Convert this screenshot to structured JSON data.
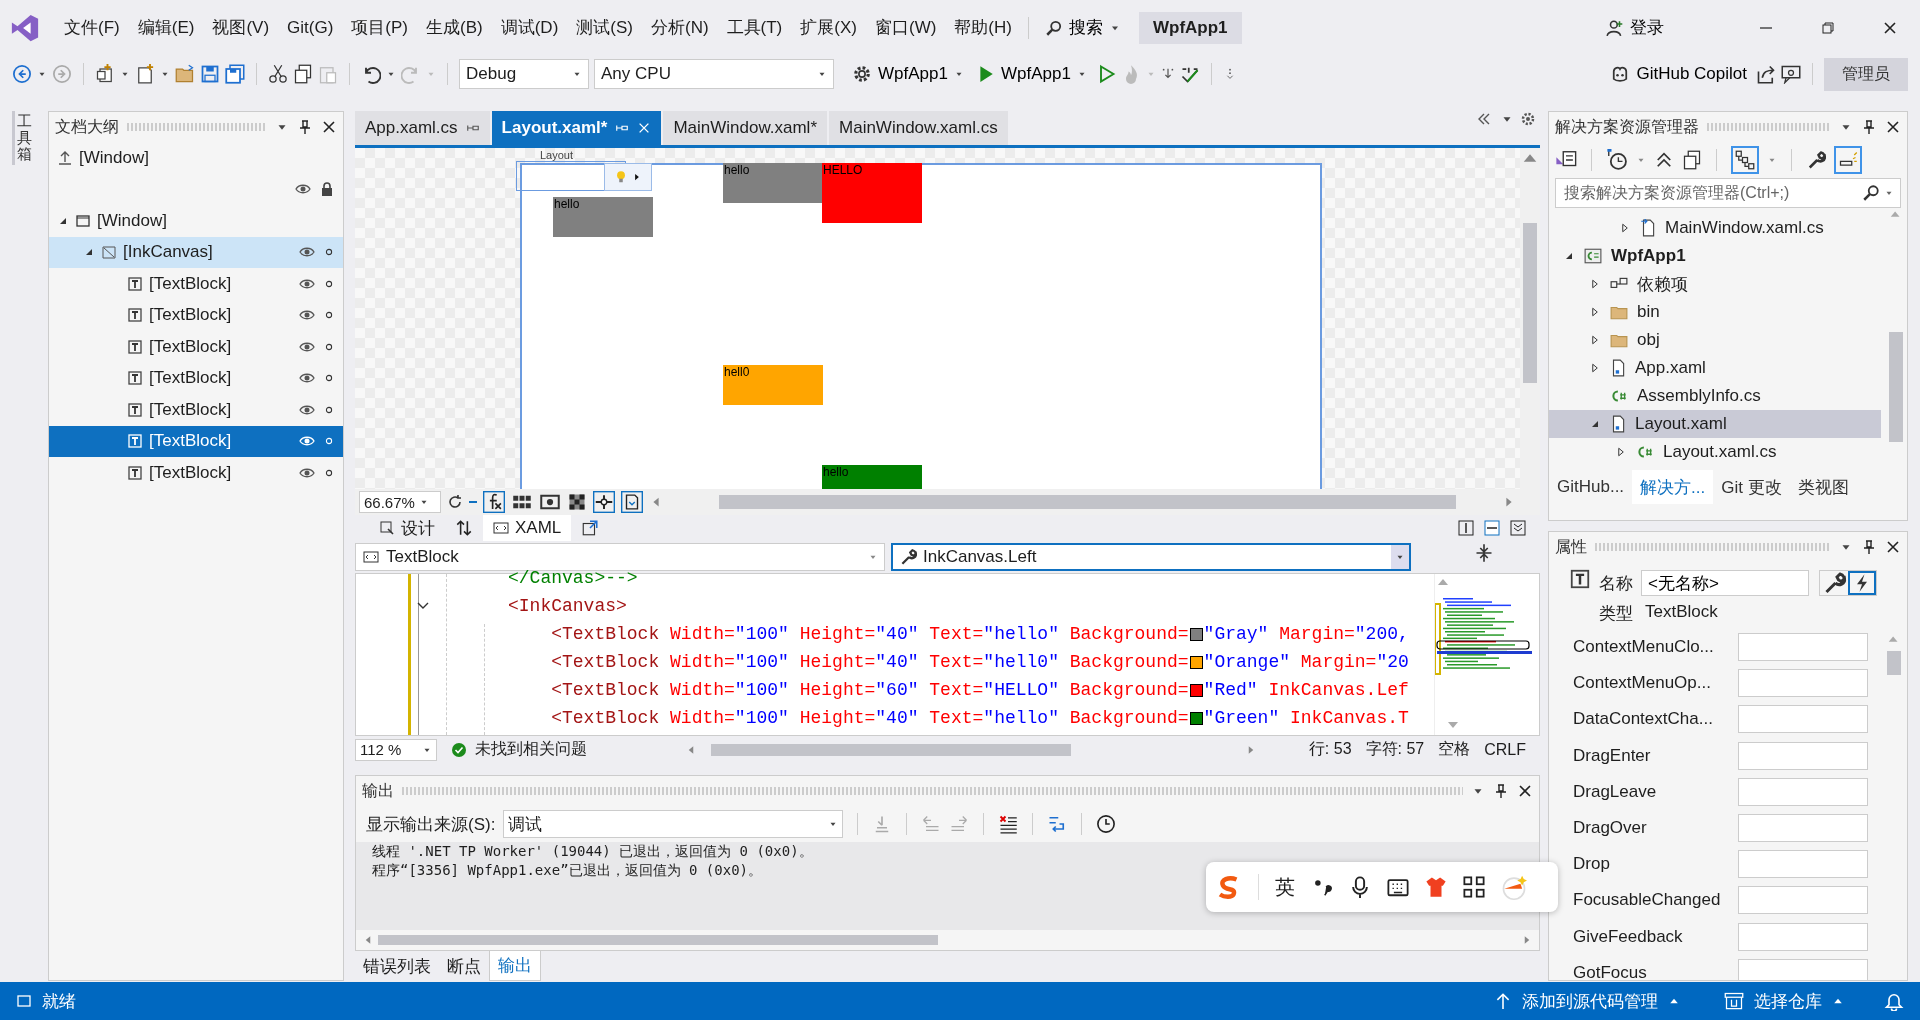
{
  "menu_bar": {
    "items": [
      "文件(F)",
      "编辑(E)",
      "视图(V)",
      "Git(G)",
      "项目(P)",
      "生成(B)",
      "调试(D)",
      "测试(S)",
      "分析(N)",
      "工具(T)",
      "扩展(X)",
      "窗口(W)",
      "帮助(H)"
    ],
    "search": "搜索",
    "solution": "WpfApp1",
    "login": "登录"
  },
  "toolbar": {
    "configuration": "Debug",
    "platform": "Any CPU",
    "startup_project": "WpfApp1",
    "run_target": "WpfApp1",
    "copilot": "GitHub Copilot",
    "admin": "管理员"
  },
  "toolbox_tab": "工具箱",
  "document_outline": {
    "title": "文档大纲",
    "scope": "[Window]",
    "tree": [
      {
        "label": "[Window]",
        "expanded": true,
        "selected": false,
        "highlighted": false,
        "children": [
          {
            "label": "[InkCanvas]",
            "expanded": true,
            "selected": false,
            "highlighted": true,
            "children": [
              {
                "label": "[TextBlock]",
                "selected": false
              },
              {
                "label": "[TextBlock]",
                "selected": false
              },
              {
                "label": "[TextBlock]",
                "selected": false
              },
              {
                "label": "[TextBlock]",
                "selected": false
              },
              {
                "label": "[TextBlock]",
                "selected": false
              },
              {
                "label": "[TextBlock]",
                "selected": true
              },
              {
                "label": "[TextBlock]",
                "selected": false
              }
            ]
          }
        ]
      }
    ]
  },
  "doc_tabs": [
    {
      "label": "App.xaml.cs",
      "selected": false,
      "pinned": true
    },
    {
      "label": "Layout.xaml*",
      "selected": true,
      "pinned": true
    },
    {
      "label": "MainWindow.xaml*",
      "selected": false,
      "pinned": false
    },
    {
      "label": "MainWindow.xaml.cs",
      "selected": false,
      "pinned": false
    }
  ],
  "designer": {
    "root_label": "Layout",
    "blocks": [
      {
        "text": "hello",
        "color": "#808080"
      },
      {
        "text": "hello",
        "color": "#808080"
      },
      {
        "text": "HELLO",
        "color": "#ff0000"
      },
      {
        "text": "hell0",
        "color": "#ffa500"
      },
      {
        "text": "hello",
        "color": "#008000"
      }
    ],
    "zoom": "66.67%"
  },
  "view_tabs": [
    {
      "label": "设计",
      "selected": false
    },
    {
      "label": "XAML",
      "selected": true
    }
  ],
  "xaml_editor": {
    "element_combo": "TextBlock",
    "member_combo": "InkCanvas.Left",
    "lines": [
      {
        "fold": false,
        "tokens": [
          {
            "kind": "comment",
            "text": "</Canvas>-->"
          }
        ]
      },
      {
        "fold": true,
        "tokens": [
          {
            "kind": "tag",
            "text": "<InkCanvas>"
          }
        ]
      },
      {
        "fold": false,
        "tokens": [
          {
            "kind": "tag",
            "text": "    <TextBlock"
          },
          {
            "kind": "attr",
            "text": " Width="
          },
          {
            "kind": "value",
            "text": "\"100\""
          },
          {
            "kind": "attr",
            "text": " Height="
          },
          {
            "kind": "value",
            "text": "\"40\""
          },
          {
            "kind": "attr",
            "text": " Text="
          },
          {
            "kind": "value",
            "text": "\"hello\""
          },
          {
            "kind": "attr",
            "text": " Background="
          },
          {
            "kind": "swatch",
            "color": "#808080"
          },
          {
            "kind": "value",
            "text": "\"Gray\""
          },
          {
            "kind": "attr",
            "text": " Margin="
          },
          {
            "kind": "value",
            "text": "\"200,"
          }
        ]
      },
      {
        "fold": false,
        "tokens": [
          {
            "kind": "tag",
            "text": "    <TextBlock"
          },
          {
            "kind": "attr",
            "text": " Width="
          },
          {
            "kind": "value",
            "text": "\"100\""
          },
          {
            "kind": "attr",
            "text": " Height="
          },
          {
            "kind": "value",
            "text": "\"40\""
          },
          {
            "kind": "attr",
            "text": " Text="
          },
          {
            "kind": "value",
            "text": "\"hell0\""
          },
          {
            "kind": "attr",
            "text": " Background="
          },
          {
            "kind": "swatch",
            "color": "#ffa500"
          },
          {
            "kind": "value",
            "text": "\"Orange\""
          },
          {
            "kind": "attr",
            "text": " Margin="
          },
          {
            "kind": "value",
            "text": "\"20"
          }
        ]
      },
      {
        "fold": false,
        "tokens": [
          {
            "kind": "tag",
            "text": "    <TextBlock"
          },
          {
            "kind": "attr",
            "text": " Width="
          },
          {
            "kind": "value",
            "text": "\"100\""
          },
          {
            "kind": "attr",
            "text": " Height="
          },
          {
            "kind": "value",
            "text": "\"60\""
          },
          {
            "kind": "attr",
            "text": " Text="
          },
          {
            "kind": "value",
            "text": "\"HELLO\""
          },
          {
            "kind": "attr",
            "text": " Background="
          },
          {
            "kind": "swatch",
            "color": "#ff0000"
          },
          {
            "kind": "value",
            "text": "\"Red\""
          },
          {
            "kind": "attr",
            "text": " InkCanvas.Lef"
          }
        ]
      },
      {
        "fold": false,
        "tokens": [
          {
            "kind": "tag",
            "text": "    <TextBlock"
          },
          {
            "kind": "attr",
            "text": " Width="
          },
          {
            "kind": "value",
            "text": "\"100\""
          },
          {
            "kind": "attr",
            "text": " Height="
          },
          {
            "kind": "value",
            "text": "\"40\""
          },
          {
            "kind": "attr",
            "text": " Text="
          },
          {
            "kind": "value",
            "text": "\"hello\""
          },
          {
            "kind": "attr",
            "text": " Background="
          },
          {
            "kind": "swatch",
            "color": "#008000"
          },
          {
            "kind": "value",
            "text": "\"Green\""
          },
          {
            "kind": "attr",
            "text": " InkCanvas.T"
          }
        ]
      }
    ],
    "zoom": "112 %",
    "issues": "未找到相关问题",
    "line": "行: 53",
    "char": "字符: 57",
    "indent": "空格",
    "eol": "CRLF"
  },
  "output": {
    "title": "输出",
    "source_label": "显示输出来源(S):",
    "source": "调试",
    "lines": [
      "线程 '.NET TP Worker' (19044) 已退出，返回值为 0 (0x0)。",
      "程序“[3356] WpfApp1.exe”已退出，返回值为 0 (0x0)。"
    ]
  },
  "bottom_tabs": [
    {
      "label": "错误列表",
      "selected": false
    },
    {
      "label": "断点",
      "selected": false
    },
    {
      "label": "输出",
      "selected": true
    }
  ],
  "solution_explorer": {
    "title": "解决方案资源管理器",
    "search_placeholder": "搜索解决方案资源管理器(Ctrl+;)",
    "tree": [
      {
        "label": "MainWindow.xaml.cs",
        "kind": "file",
        "expanded": false,
        "selected": false
      },
      {
        "label": "WpfApp1",
        "kind": "project",
        "expanded": true,
        "selected": false,
        "children": [
          {
            "label": "依赖项",
            "kind": "dependencies",
            "expanded": false,
            "selected": false
          },
          {
            "label": "bin",
            "kind": "folder",
            "expanded": false,
            "selected": false
          },
          {
            "label": "obj",
            "kind": "folder",
            "expanded": false,
            "selected": false
          },
          {
            "label": "App.xaml",
            "kind": "xaml",
            "expanded": false,
            "selected": false
          },
          {
            "label": "AssemblyInfo.cs",
            "kind": "csharp",
            "selected": false
          },
          {
            "label": "Layout.xaml",
            "kind": "xaml",
            "expanded": true,
            "selected": true,
            "children": [
              {
                "label": "Layout.xaml.cs",
                "kind": "csharp",
                "expanded": false,
                "selected": false
              }
            ]
          }
        ]
      }
    ]
  },
  "side_tabs": [
    {
      "label": "GitHub...",
      "selected": false
    },
    {
      "label": "解决方...",
      "selected": true
    },
    {
      "label": "Git 更改",
      "selected": false
    },
    {
      "label": "类视图",
      "selected": false
    }
  ],
  "properties": {
    "title": "属性",
    "name_label": "名称",
    "name_value": "<无名称>",
    "type_label": "类型",
    "type_value": "TextBlock",
    "events": [
      "ContextMenuClo...",
      "ContextMenuOp...",
      "DataContextCha...",
      "DragEnter",
      "DragLeave",
      "DragOver",
      "Drop",
      "FocusableChanged",
      "GiveFeedback",
      "GotFocus"
    ]
  },
  "status_bar": {
    "status": "就绪",
    "source_control": "添加到源代码管理",
    "repository": "选择仓库"
  },
  "ime_bar": {
    "language": "英"
  }
}
